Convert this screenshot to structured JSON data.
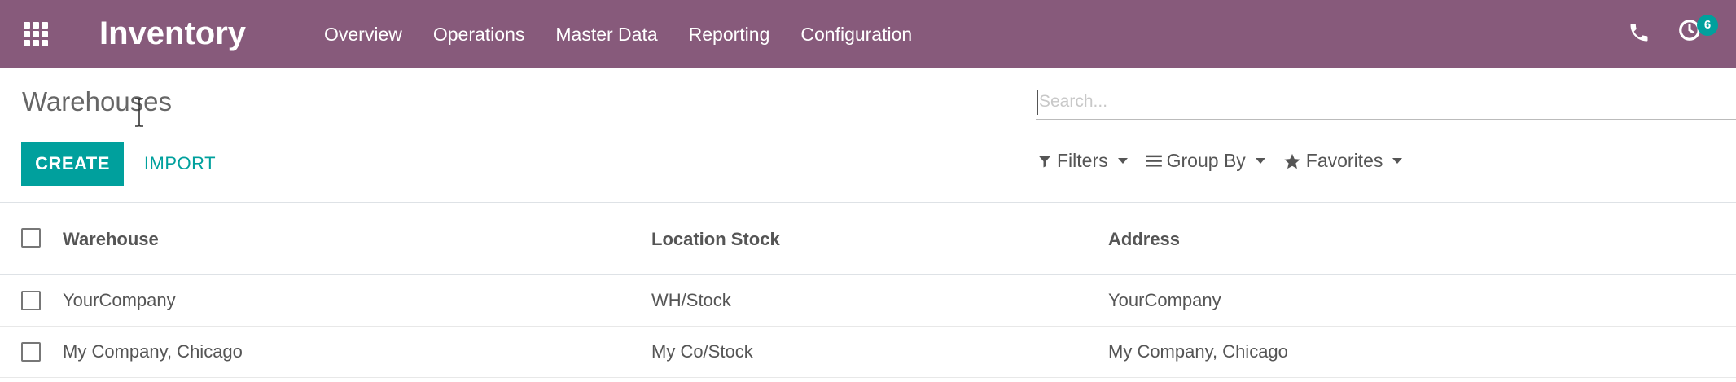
{
  "navbar": {
    "brand": "Inventory",
    "menu": [
      {
        "label": "Overview"
      },
      {
        "label": "Operations"
      },
      {
        "label": "Master Data"
      },
      {
        "label": "Reporting"
      },
      {
        "label": "Configuration"
      }
    ],
    "activity_badge": "6",
    "icons": [
      "apps-grid-icon",
      "phone-icon",
      "activity-clock-icon"
    ],
    "background_color": "#875a7b"
  },
  "control_panel": {
    "breadcrumb": "Warehouses",
    "search": {
      "placeholder": "Search...",
      "value": ""
    },
    "create_label": "CREATE",
    "import_label": "IMPORT",
    "filters_label": "Filters",
    "group_by_label": "Group By",
    "favorites_label": "Favorites",
    "accent_color": "#00a09d"
  },
  "list": {
    "columns": [
      "Warehouse",
      "Location Stock",
      "Address"
    ],
    "rows": [
      {
        "warehouse": "YourCompany",
        "location_stock": "WH/Stock",
        "address": "YourCompany"
      },
      {
        "warehouse": "My Company, Chicago",
        "location_stock": "My Co/Stock",
        "address": "My Company, Chicago"
      }
    ]
  }
}
